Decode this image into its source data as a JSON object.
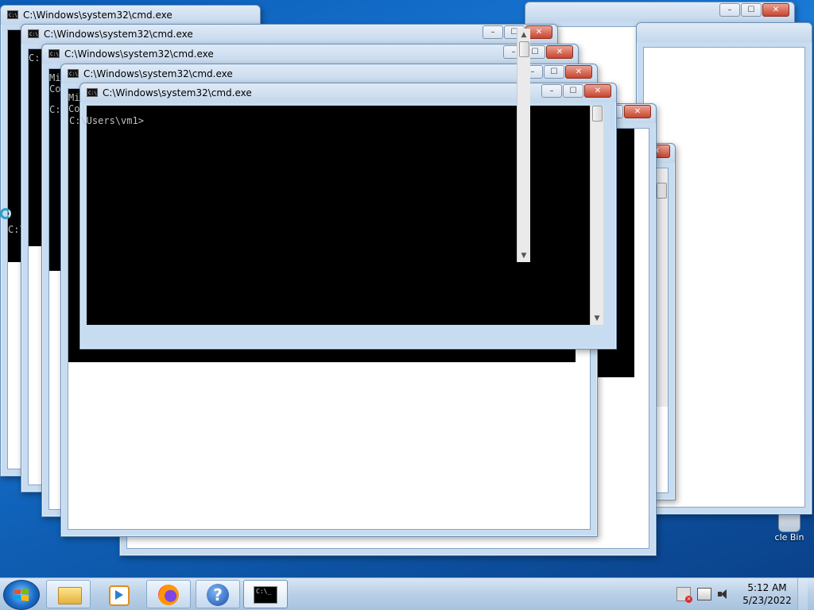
{
  "window_title": "C:\\Windows\\system32\\cmd.exe",
  "console": {
    "prompt": "C:\\Users\\vm1>",
    "partial_lines": [
      "Mi",
      "Co",
      "C:"
    ],
    "partial_prompt_back": "C:\\Use"
  },
  "caption_buttons": {
    "minimize": "–",
    "maximize": "☐",
    "close": "✕"
  },
  "desktop": {
    "recycle_bin_label": "cle Bin"
  },
  "taskbar": {
    "start_label": "Start",
    "pinned": [
      "windows-explorer",
      "media-player",
      "firefox",
      "help",
      "command-prompt"
    ]
  },
  "clock": {
    "time": "5:12 AM",
    "date": "5/23/2022"
  },
  "colors": {
    "console_bg": "#000000",
    "console_fg": "#c0c0c0",
    "frame": "#c7dcf0",
    "close": "#c9442e"
  }
}
